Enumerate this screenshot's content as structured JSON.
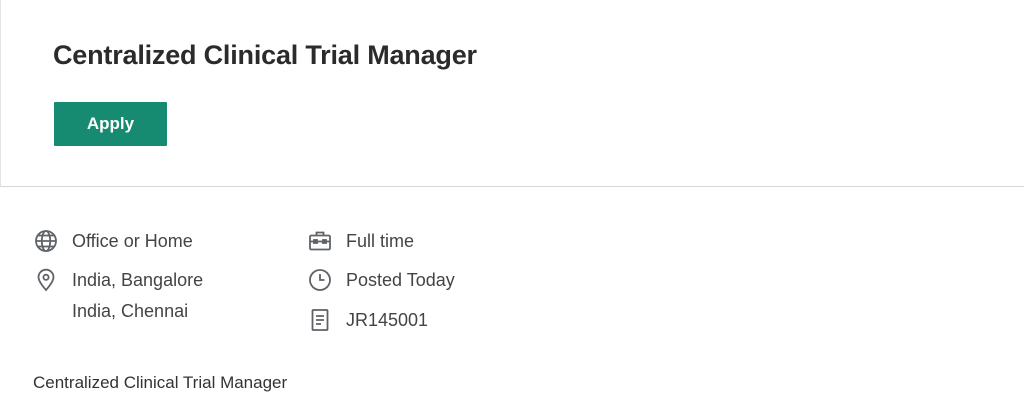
{
  "job": {
    "title": "Centralized Clinical Trial Manager",
    "apply_label": "Apply"
  },
  "details": {
    "work_mode": {
      "icon": "globe-icon",
      "label": "Office or Home"
    },
    "locations": {
      "icon": "location-pin-icon",
      "items": [
        "India, Bangalore",
        "India, Chennai"
      ]
    },
    "employment_type": {
      "icon": "briefcase-icon",
      "label": "Full time"
    },
    "posted": {
      "icon": "clock-icon",
      "label": "Posted Today"
    },
    "requisition": {
      "icon": "document-icon",
      "label": "JR145001"
    }
  },
  "description": {
    "first_line": "Centralized Clinical Trial Manager"
  },
  "colors": {
    "accent": "#178a72",
    "icon": "#5f6368",
    "text": "#333333"
  }
}
